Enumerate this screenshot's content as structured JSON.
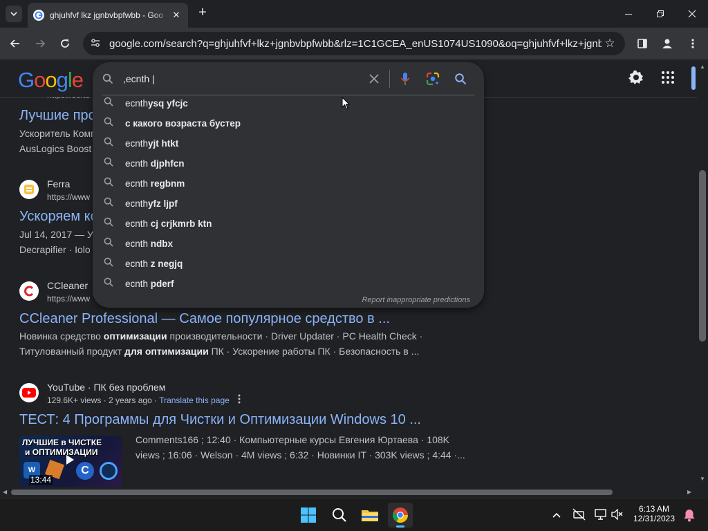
{
  "browser": {
    "tab_title": "ghjuhfvf lkz jgnbvbpfwbb - Goo",
    "url": "google.com/search?q=ghjuhfvf+lkz+jgnbvbpfwbb&rlz=1C1GCEA_enUS1074US1090&oq=ghjuhfvf+lkz+jgnbvbp..."
  },
  "google": {
    "logo": [
      "G",
      "o",
      "o",
      "g",
      "l",
      "e"
    ],
    "logo_colors": [
      "#4285f4",
      "#ea4335",
      "#fbbc05",
      "#4285f4",
      "#34a853",
      "#ea4335"
    ],
    "search_query": ",ecnth |",
    "suggestions": [
      {
        "plain": "ecnth",
        "bold": "ysq yfcjc"
      },
      {
        "plain": "",
        "bold": "с какого возраста бустер"
      },
      {
        "plain": "ecnth",
        "bold": "yjt htkt"
      },
      {
        "plain": "ecnth ",
        "bold": "djphfcn"
      },
      {
        "plain": "ecnth ",
        "bold": "regbnm"
      },
      {
        "plain": "ecnth",
        "bold": "yfz ljpf"
      },
      {
        "plain": "ecnth ",
        "bold": "cj crjkmrb ktn"
      },
      {
        "plain": "ecnth ",
        "bold": "ndbx"
      },
      {
        "plain": "ecnth ",
        "bold": "z negjq"
      },
      {
        "plain": "ecnth ",
        "bold": "pderf"
      }
    ],
    "report_link": "Report inappropriate predictions"
  },
  "results": {
    "r0": {
      "url_partial": "https://softo",
      "title": "Лучшие про",
      "snippet1": "Ускоритель Комп",
      "snippet2": "AusLogics Boost"
    },
    "r1": {
      "site": "Ferra",
      "url": "https://www",
      "title": "Ускоряем ко",
      "snippet1": "Jul 14, 2017 — Ус",
      "snippet2": "Decrapifier · Iolo"
    },
    "r2": {
      "site": "CCleaner",
      "url": "https://www",
      "title": "CCleaner Professional — Самое популярное средство в ...",
      "s1a": "Новинка средство ",
      "s1b": "оптимизации",
      "s1c": " производительности · Driver Updater · PC Health Check ·",
      "s2a": "Титулованный продукт ",
      "s2b": "для оптимизации",
      "s2c": " ПК · Ускорение работы ПК · Безопасность в ..."
    },
    "r3": {
      "site": "YouTube · ПК без проблем",
      "meta": "129.6K+ views · 2 years ago · ",
      "translate": "Translate this page",
      "title": "ТЕСТ: 4 Программы для Чистки и Оптимизации Windows 10 ...",
      "snippet1": "Comments166 ; 12:40 · Компьютерные курсы Евгения Юртаева · 108K",
      "snippet2": "views ; 16:06 · Welson · 4M views ; 6:32 · Новинки IT · 303K views ; 4:44 ·...",
      "thumb_line1": "ЛУЧШИЕ в ЧИСТКЕ",
      "thumb_line2": "и ОПТИМИЗАЦИИ",
      "duration": "13:44"
    }
  },
  "taskbar": {
    "time": "6:13 AM",
    "date": "12/31/2023"
  },
  "colors": {
    "accent": "#8ab4f8",
    "background": "#202124"
  }
}
